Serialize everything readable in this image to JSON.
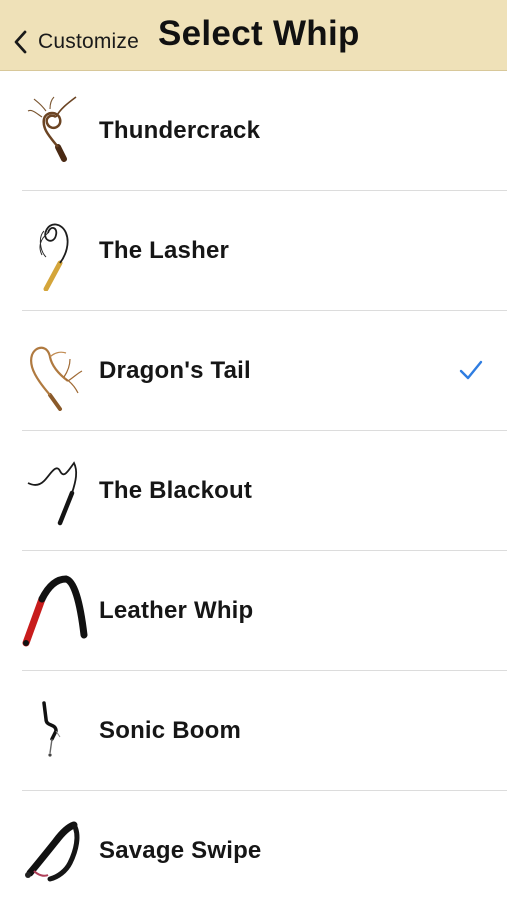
{
  "nav": {
    "back_label": "Customize",
    "title": "Select Whip",
    "background": "#efe1b8"
  },
  "accent_color": "#2f7de1",
  "whips": [
    {
      "name": "Thundercrack",
      "icon": "thundercrack-whip-icon",
      "selected": false
    },
    {
      "name": "The Lasher",
      "icon": "the-lasher-whip-icon",
      "selected": false
    },
    {
      "name": "Dragon's Tail",
      "icon": "dragons-tail-whip-icon",
      "selected": true
    },
    {
      "name": "The Blackout",
      "icon": "the-blackout-whip-icon",
      "selected": false
    },
    {
      "name": "Leather Whip",
      "icon": "leather-whip-icon",
      "selected": false
    },
    {
      "name": "Sonic Boom",
      "icon": "sonic-boom-whip-icon",
      "selected": false
    },
    {
      "name": "Savage Swipe",
      "icon": "savage-swipe-whip-icon",
      "selected": false
    }
  ]
}
